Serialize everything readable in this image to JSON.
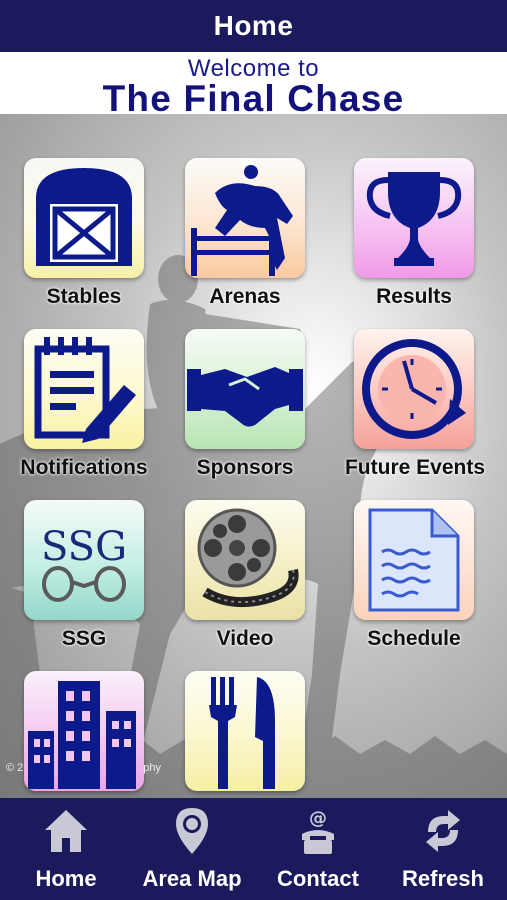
{
  "header": {
    "title": "Home"
  },
  "welcome": {
    "line1": "Welcome to",
    "line2": "The Final Chase"
  },
  "tiles": [
    {
      "label": "Stables",
      "icon": "barn-icon"
    },
    {
      "label": "Arenas",
      "icon": "show-jumping-icon"
    },
    {
      "label": "Results",
      "icon": "trophy-icon"
    },
    {
      "label": "Notifications",
      "icon": "notepad-pencil-icon"
    },
    {
      "label": "Sponsors",
      "icon": "handshake-icon"
    },
    {
      "label": "Future Events",
      "icon": "clock-icon"
    },
    {
      "label": "SSG",
      "icon": "ssg-logo-icon",
      "logo_text": "SSG"
    },
    {
      "label": "Video",
      "icon": "film-reel-icon"
    },
    {
      "label": "Schedule",
      "icon": "document-icon"
    },
    {
      "label": "",
      "icon": "city-buildings-icon"
    },
    {
      "label": "",
      "icon": "fork-knife-icon"
    }
  ],
  "background": {
    "copyright_left": "© 2",
    "copyright_right": "phy"
  },
  "bottom_nav": [
    {
      "label": "Home",
      "icon": "house-icon"
    },
    {
      "label": "Area Map",
      "icon": "map-pin-icon"
    },
    {
      "label": "Contact",
      "icon": "phone-icon"
    },
    {
      "label": "Refresh",
      "icon": "refresh-icon"
    }
  ],
  "colors": {
    "bar": "#1a1a5c",
    "icon_blue": "#0d1a8c",
    "title_blue": "#12127a"
  }
}
